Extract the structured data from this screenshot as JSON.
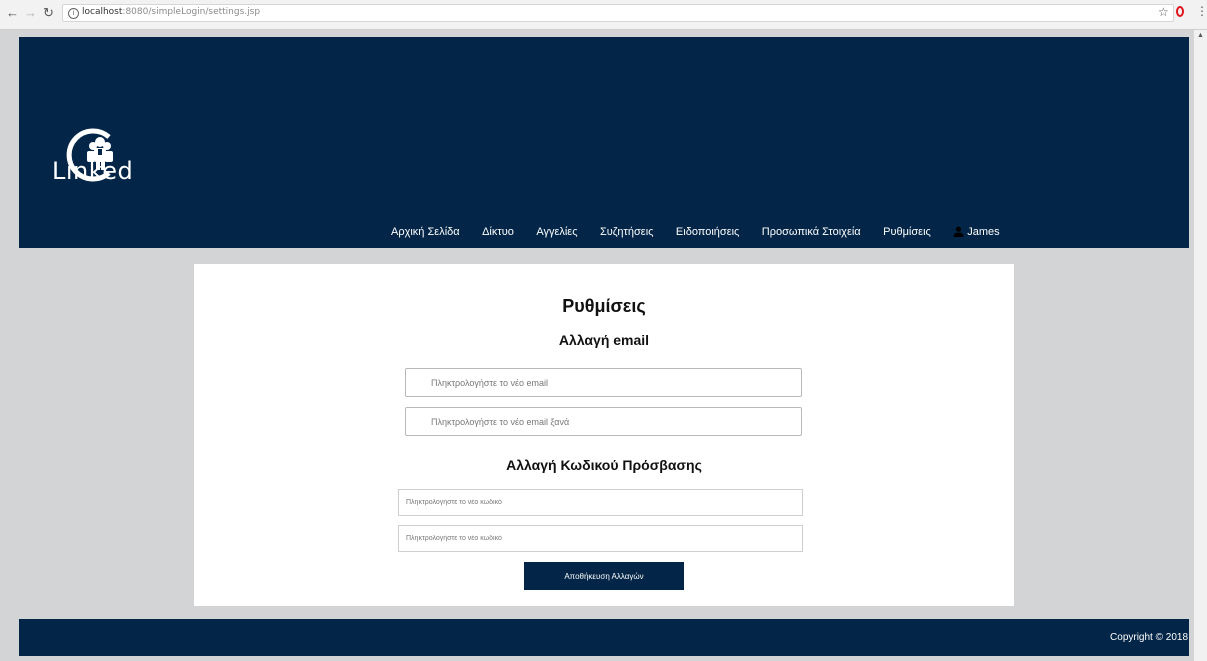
{
  "browser": {
    "url_host": "localhost",
    "url_rest": ":8080/simpleLogin/settings.jsp",
    "icons": [
      "back-arrow-icon",
      "forward-arrow-icon",
      "reload-icon",
      "info-icon",
      "star-icon",
      "opera-icon",
      "menu-icon"
    ]
  },
  "header": {
    "logo_text": "Linked",
    "nav": [
      {
        "label": "Αρχική Σελίδα"
      },
      {
        "label": "Δίκτυο"
      },
      {
        "label": "Αγγελίες"
      },
      {
        "label": "Συζητήσεις"
      },
      {
        "label": "Ειδοποιήσεις"
      },
      {
        "label": "Προσωπικά Στοιχεία"
      },
      {
        "label": "Ρυθμίσεις"
      }
    ],
    "user": {
      "name": "James",
      "icon": "user-icon"
    }
  },
  "settings": {
    "title": "Ρυθμίσεις",
    "email_heading": "Αλλαγή email",
    "email_placeholder": "Πληκτρολογήστε το νέο email",
    "email_confirm_placeholder": "Πληκτρολογήστε το νέο email ξανά",
    "password_heading": "Αλλαγή Κωδικού Πρόσβασης",
    "password_placeholder": "Πληκτρολογήστε το νέο κωδικό",
    "password_confirm_placeholder": "Πληκτρολογήστε το νέο κωδικό",
    "save_label": "Αποθήκευση Αλλαγών"
  },
  "footer": {
    "copyright": "Copyright © 2018"
  },
  "colors": {
    "brand": "#032547",
    "page_bg": "#d3d4d6",
    "card_bg": "#ffffff"
  }
}
